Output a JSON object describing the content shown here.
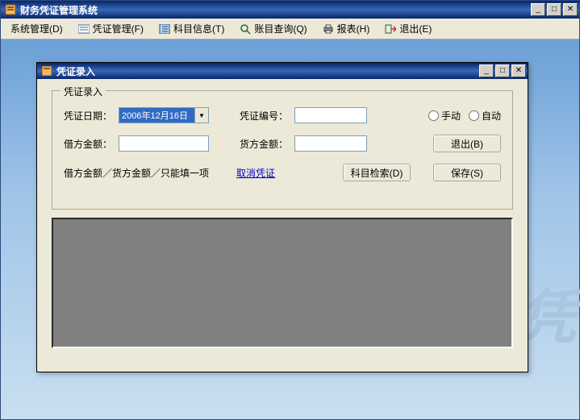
{
  "app": {
    "title": "财务凭证管理系统"
  },
  "menu": {
    "system": "系统管理(D)",
    "voucher": "凭证管理(F)",
    "subject": "科目信息(T)",
    "query": "账目查询(Q)",
    "report": "报表(H)",
    "exit": "退出(E)"
  },
  "dialog": {
    "title": "凭证录入",
    "groupTitle": "凭证录入",
    "dateLabel": "凭证日期：",
    "dateValue": "2006年12月16日",
    "numberLabel": "凭证编号：",
    "numberValue": "",
    "radioManual": "手动",
    "radioAuto": "自动",
    "debitLabel": "借方金额：",
    "debitValue": "",
    "creditLabel": "货方金额：",
    "creditValue": "",
    "note": "借方金额／货方金额／只能填一项",
    "cancelLink": "取消凭证",
    "subjectSearch": "科目检索(D)",
    "exitBtn": "退出(B)",
    "saveBtn": "保存(S)"
  },
  "watermark": "务凭"
}
